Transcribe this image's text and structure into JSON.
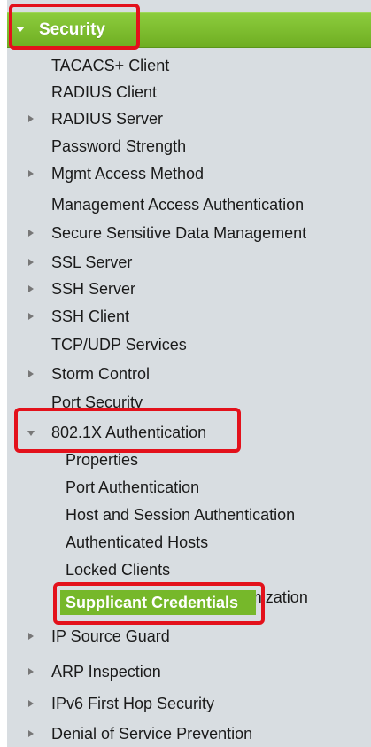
{
  "nav": {
    "section_title": "Security",
    "items": [
      {
        "label": "TACACS+ Client"
      },
      {
        "label": "RADIUS Client"
      },
      {
        "label": "RADIUS Server"
      },
      {
        "label": "Password Strength"
      },
      {
        "label": "Mgmt Access Method"
      },
      {
        "label": "Management Access Authentication"
      },
      {
        "label": "Secure Sensitive Data Management"
      },
      {
        "label": "SSL Server"
      },
      {
        "label": "SSH Server"
      },
      {
        "label": "SSH Client"
      },
      {
        "label": "TCP/UDP Services"
      },
      {
        "label": "Storm Control"
      },
      {
        "label": "Port Security"
      },
      {
        "label": "802.1X Authentication"
      },
      {
        "label": "Properties"
      },
      {
        "label": "Port Authentication"
      },
      {
        "label": "Host and Session Authentication"
      },
      {
        "label": "Authenticated Hosts"
      },
      {
        "label": "Locked Clients"
      },
      {
        "label": "Web Authentication Customization"
      },
      {
        "label": "Supplicant Credentials"
      },
      {
        "label": "IP Source Guard"
      },
      {
        "label": "ARP Inspection"
      },
      {
        "label": "IPv6 First Hop Security"
      },
      {
        "label": "Denial of Service Prevention"
      }
    ]
  },
  "colors": {
    "header_green": "#76b82a",
    "selected_green": "#76b82a",
    "highlight_red": "#e3111b",
    "nav_background": "#d8dde1"
  }
}
